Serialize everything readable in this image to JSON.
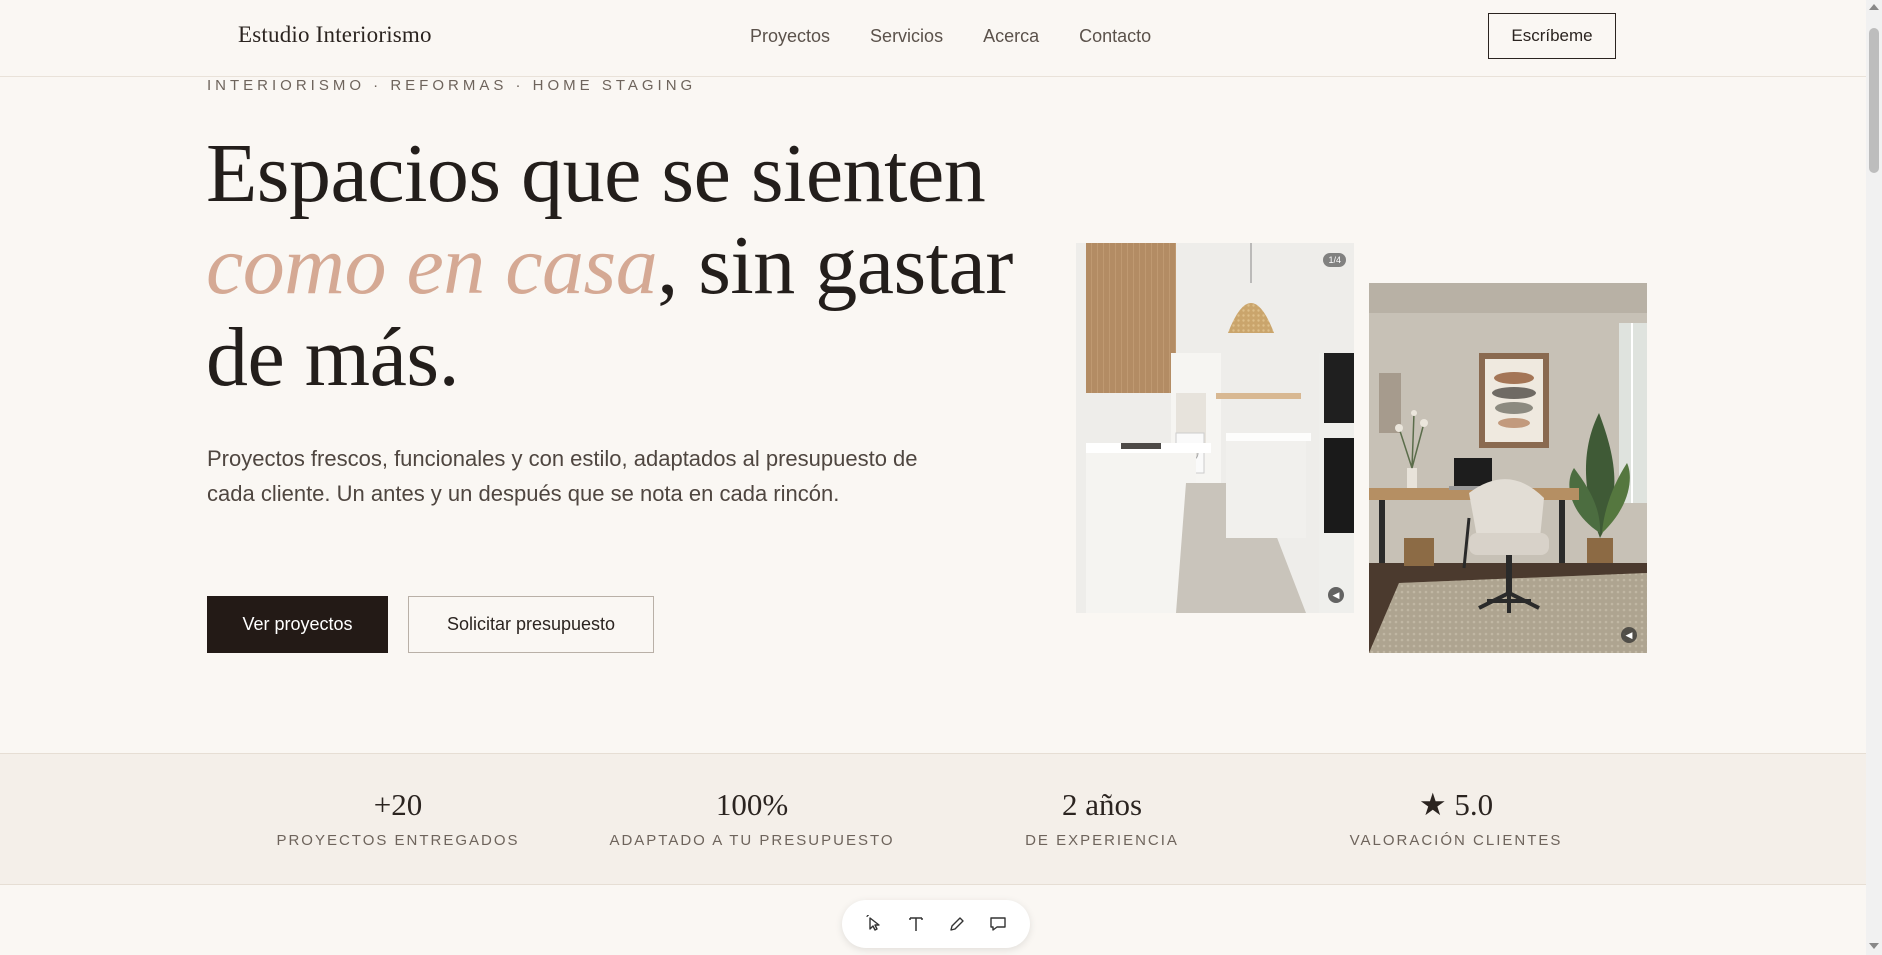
{
  "header": {
    "brand": "Estudio Interiorismo",
    "nav": [
      "Proyectos",
      "Servicios",
      "Acerca",
      "Contacto"
    ],
    "cta": "Escríbeme"
  },
  "hero": {
    "eyebrow": "INTERIORISMO · REFORMAS · HOME STAGING",
    "headline_line1": "Espacios que se sienten",
    "headline_accent": "como en casa",
    "headline_line2_rest": ", sin gastar",
    "headline_line3": "de más.",
    "lead": "Proyectos frescos, funcionales y con estilo, adaptados al presupuesto de cada cliente. Un antes y un después que se nota en cada rincón.",
    "primary_button": "Ver proyectos",
    "secondary_button": "Solicitar presupuesto",
    "photo_badge": "1/4"
  },
  "stats": [
    {
      "value": "+20",
      "label": "PROYECTOS ENTREGADOS"
    },
    {
      "value": "100%",
      "label": "ADAPTADO A TU PRESUPUESTO"
    },
    {
      "value": "2 años",
      "label": "DE EXPERIENCIA"
    },
    {
      "value": "★ 5.0",
      "label": "VALORACIÓN CLIENTES"
    }
  ],
  "toolbar": {
    "icons": [
      "select-icon",
      "text-icon",
      "pen-icon",
      "comment-icon"
    ]
  },
  "colors": {
    "background": "#faf7f3",
    "accent": "#d5a994",
    "dark": "#231a16",
    "band": "#f4efe9"
  }
}
